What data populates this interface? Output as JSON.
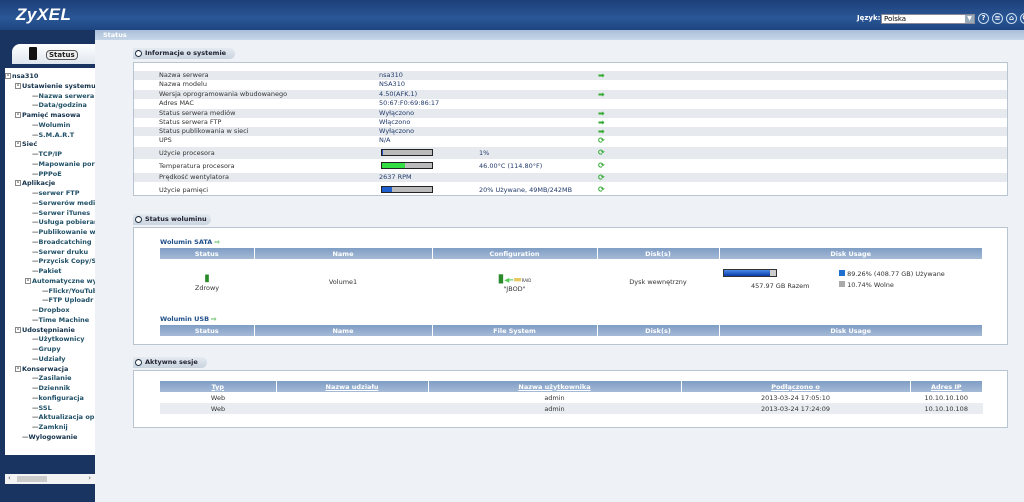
{
  "header": {
    "logo": "ZyXEL",
    "language_label": "Język:",
    "language_value": "Polska",
    "icons": [
      "help-icon",
      "sitemap-icon",
      "home-icon",
      "logout-icon"
    ]
  },
  "topbar": {
    "title": "Status"
  },
  "sidebar": {
    "status_tab": "Status",
    "tree": [
      {
        "label": "nsa310",
        "level": 0,
        "pm": "-"
      },
      {
        "label": "Ustawienie systemu",
        "level": 1,
        "pm": "-"
      },
      {
        "label": "Nazwa serwera",
        "level": 2
      },
      {
        "label": "Data/godzina",
        "level": 2
      },
      {
        "label": "Pamięć masowa",
        "level": 1,
        "pm": "-"
      },
      {
        "label": "Wolumin",
        "level": 2
      },
      {
        "label": "S.M.A.R.T",
        "level": 2
      },
      {
        "label": "Sieć",
        "level": 1,
        "pm": "-"
      },
      {
        "label": "TCP/IP",
        "level": 2
      },
      {
        "label": "Mapowanie portów",
        "level": 2
      },
      {
        "label": "PPPoE",
        "level": 2
      },
      {
        "label": "Aplikacje",
        "level": 1,
        "pm": "-"
      },
      {
        "label": "serwer FTP",
        "level": 2
      },
      {
        "label": "Serwerów mediów",
        "level": 2
      },
      {
        "label": "Serwer iTunes",
        "level": 2
      },
      {
        "label": "Usługa pobierania",
        "level": 2
      },
      {
        "label": "Publikowanie w sieci",
        "level": 2
      },
      {
        "label": "Broadcatching",
        "level": 2
      },
      {
        "label": "Serwer druku",
        "level": 2
      },
      {
        "label": "Przycisk Copy/Sync",
        "level": 2
      },
      {
        "label": "Pakiet",
        "level": 2
      },
      {
        "label": "Automatyczne wysyłanie",
        "level": 2,
        "pm": "-"
      },
      {
        "label": "Flickr/YouTube",
        "level": 3
      },
      {
        "label": "FTP Uploadr",
        "level": 3
      },
      {
        "label": "Dropbox",
        "level": 2
      },
      {
        "label": "Time Machine",
        "level": 2
      },
      {
        "label": "Udostępnianie",
        "level": 1,
        "pm": "-"
      },
      {
        "label": "Użytkownicy",
        "level": 2
      },
      {
        "label": "Grupy",
        "level": 2
      },
      {
        "label": "Udziały",
        "level": 2
      },
      {
        "label": "Konserwacja",
        "level": 1,
        "pm": "-"
      },
      {
        "label": "Zasilanie",
        "level": 2
      },
      {
        "label": "Dziennik",
        "level": 2
      },
      {
        "label": "konfiguracja",
        "level": 2
      },
      {
        "label": "SSL",
        "level": 2
      },
      {
        "label": "Aktualizacja oprogramowania",
        "level": 2
      },
      {
        "label": "Zamknij",
        "level": 2
      },
      {
        "label": "Wylogowanie",
        "level": 1
      }
    ]
  },
  "system_info": {
    "title": "Informacje o systemie",
    "rows": [
      {
        "key": "Nazwa serwera",
        "value": "nsa310",
        "icon": "edit"
      },
      {
        "key": "Nazwa modelu",
        "value": "NSA310"
      },
      {
        "key": "Wersja oprogramowania wbudowanego",
        "value": "4.50(AFK.1)",
        "icon": "edit"
      },
      {
        "key": "Adres MAC",
        "value": "50:67:F0:69:86:17"
      },
      {
        "key": "Status serwera mediów",
        "value": "Wyłączono",
        "icon": "edit"
      },
      {
        "key": "Status serwera FTP",
        "value": "Włączono",
        "icon": "edit"
      },
      {
        "key": "Status publikowania w sieci",
        "value": "Wyłączono",
        "icon": "edit"
      },
      {
        "key": "UPS",
        "value": "N/A",
        "icon": "refresh"
      },
      {
        "key": "Użycie procesora",
        "bar": 0.01,
        "barColor": "#2255cc",
        "extra": "1%",
        "icon": "refresh"
      },
      {
        "key": "Temperatura procesora",
        "bar": 0.45,
        "barColor": "#33dd44",
        "extra": "46.00°C (114.80°F)",
        "icon": "refresh"
      },
      {
        "key": "Prędkość wentylatora",
        "value": "2637 RPM",
        "icon": "refresh"
      },
      {
        "key": "Użycie pamięci",
        "bar": 0.2,
        "barColor": "#1e5fd0",
        "extra": "20% Używane, 49MB/242MB",
        "icon": "refresh"
      }
    ]
  },
  "volume_status": {
    "title": "Status woluminu",
    "sata": {
      "label": "Wolumin SATA",
      "headers": [
        "Status",
        "Name",
        "Configuration",
        "Disk(s)",
        "Disk Usage"
      ],
      "row": {
        "status": "Zdrowy",
        "name": "Volume1",
        "config": "\"JBOD\"",
        "raid_label": "RAID",
        "disks": "Dysk wewnętrzny",
        "total": "457.97 GB Razem",
        "used": "89.26% (408.77 GB) Używane",
        "free": "10.74% Wolne",
        "used_fraction": 0.8926
      }
    },
    "usb": {
      "label": "Wolumin USB",
      "headers": [
        "Status",
        "Name",
        "File System",
        "Disk(s)",
        "Disk Usage"
      ]
    }
  },
  "sessions": {
    "title": "Aktywne sesje",
    "headers": [
      "Typ",
      "Nazwa udziału",
      "Nazwa użytkownika",
      "Podłączono o",
      "Adres IP"
    ],
    "rows": [
      [
        "Web",
        "",
        "admin",
        "2013-03-24 17:05:10",
        "10.10.10.100"
      ],
      [
        "Web",
        "",
        "admin",
        "2013-03-24 17:24:09",
        "10.10.10.108"
      ]
    ]
  }
}
